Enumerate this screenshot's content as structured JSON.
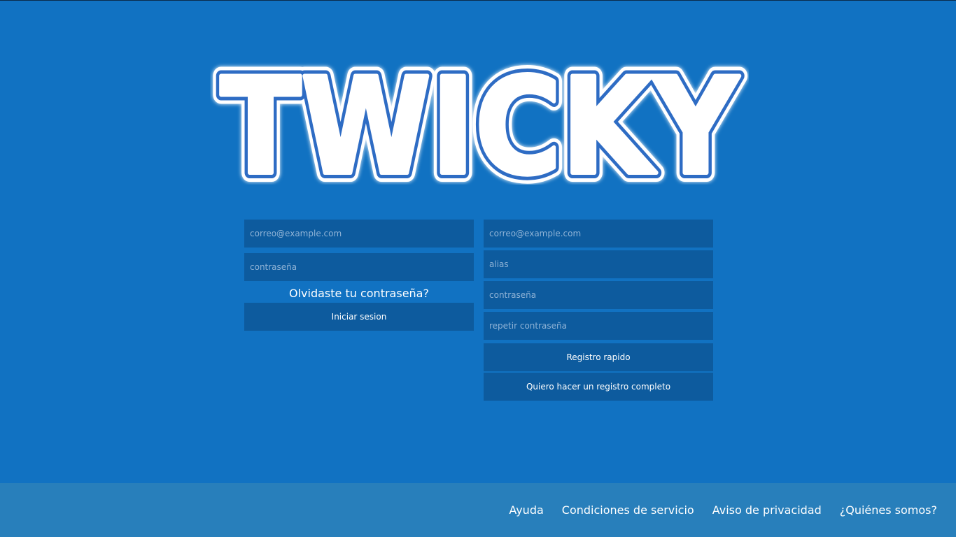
{
  "logo": {
    "text": "TWICKY"
  },
  "login": {
    "email_placeholder": "correo@example.com",
    "password_placeholder": "contraseña",
    "forgot_link": "Olvidaste tu contraseña?",
    "submit_label": "Iniciar sesion"
  },
  "register": {
    "email_placeholder": "correo@example.com",
    "alias_placeholder": "alias",
    "password_placeholder": "contraseña",
    "repeat_password_placeholder": "repetir contraseña",
    "quick_register_label": "Registro rapido",
    "full_register_label": "Quiero hacer un registro completo"
  },
  "footer": {
    "links": [
      {
        "label": "Ayuda"
      },
      {
        "label": "Condiciones de servicio"
      },
      {
        "label": "Aviso de privacidad"
      },
      {
        "label": "¿Quiénes somos?"
      }
    ]
  },
  "colors": {
    "background": "#1172c2",
    "field_background": "#0d5b9e",
    "footer_background": "#287fbb",
    "logo_outline": "#2f6cc4",
    "text": "#ffffff"
  }
}
